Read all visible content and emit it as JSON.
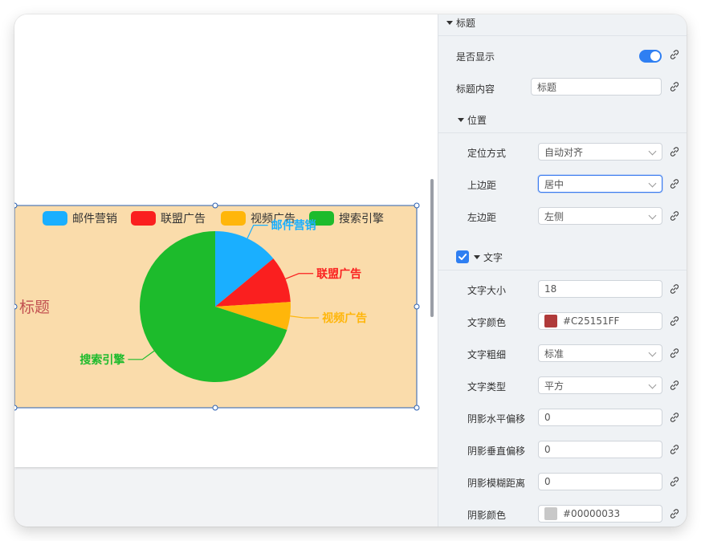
{
  "chart_data": {
    "type": "pie",
    "title": "标题",
    "legend": [
      "邮件营销",
      "联盟广告",
      "视频广告",
      "搜索引擎"
    ],
    "categories": [
      "邮件营销",
      "联盟广告",
      "视频广告",
      "搜索引擎"
    ],
    "values": [
      14,
      10,
      6,
      70
    ],
    "colors": [
      "#1aafff",
      "#fa1f1f",
      "#ffb60a",
      "#1dbb2c"
    ],
    "background": "#fadcab",
    "title_color": "#C25151",
    "legend_placement": "top"
  },
  "panel": {
    "title_section": "标题",
    "show_label": "是否显示",
    "content_label": "标题内容",
    "content_value": "标题",
    "position_section": "位置",
    "position_mode_label": "定位方式",
    "position_mode_value": "自动对齐",
    "top_margin_label": "上边距",
    "top_margin_value": "居中",
    "left_margin_label": "左边距",
    "left_margin_value": "左侧",
    "text_section": "文字",
    "font_size_label": "文字大小",
    "font_size_value": "18",
    "font_color_label": "文字颜色",
    "font_color_value": "#C25151FF",
    "font_color_swatch": "#b03a3a",
    "font_weight_label": "文字粗细",
    "font_weight_value": "标准",
    "font_type_label": "文字类型",
    "font_type_value": "平方",
    "shadow_h_label": "阴影水平偏移",
    "shadow_h_value": "0",
    "shadow_v_label": "阴影垂直偏移",
    "shadow_v_value": "0",
    "shadow_blur_label": "阴影模糊距离",
    "shadow_blur_value": "0",
    "shadow_color_label": "阴影颜色",
    "shadow_color_value": "#00000033",
    "shadow_color_swatch": "#c8c8c8"
  },
  "colors": {
    "accent": "#2f7ff2",
    "selection": "#2a5fb0"
  }
}
